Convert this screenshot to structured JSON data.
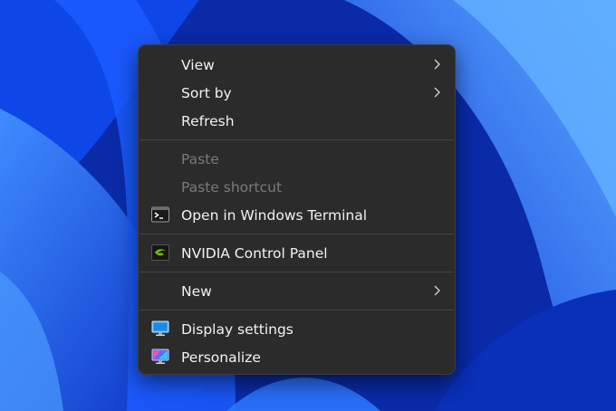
{
  "colors": {
    "menu_bg": "#2b2b2b",
    "separator": "#444444",
    "text": "#f2f2f2",
    "disabled_text": "#7a7a7a",
    "desktop_accent": "#0b3ad6"
  },
  "menu": {
    "view": {
      "label": "View",
      "has_submenu": true
    },
    "sort_by": {
      "label": "Sort by",
      "has_submenu": true
    },
    "refresh": {
      "label": "Refresh"
    },
    "paste": {
      "label": "Paste",
      "enabled": false
    },
    "paste_shortcut": {
      "label": "Paste shortcut",
      "enabled": false
    },
    "open_terminal": {
      "label": "Open in Windows Terminal",
      "icon": "terminal-icon"
    },
    "nvidia": {
      "label": "NVIDIA Control Panel",
      "icon": "nvidia-icon"
    },
    "new": {
      "label": "New",
      "has_submenu": true
    },
    "display_settings": {
      "label": "Display settings",
      "icon": "display-settings-icon"
    },
    "personalize": {
      "label": "Personalize",
      "icon": "personalize-icon"
    }
  }
}
